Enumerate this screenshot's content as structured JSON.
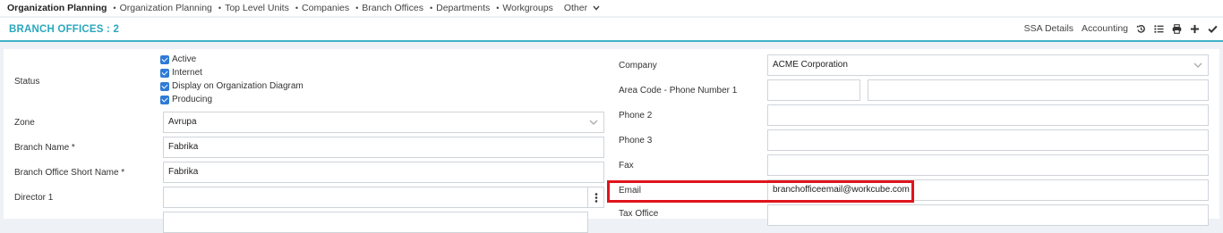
{
  "nav": {
    "items": [
      "Organization Planning",
      "Organization Planning",
      "Top Level Units",
      "Companies",
      "Branch Offices",
      "Departments",
      "Workgroups",
      "Other"
    ],
    "separator": "•"
  },
  "header": {
    "title": "BRANCH OFFICES : 2",
    "ssa_label": "SSA Details",
    "accounting_label": "Accounting"
  },
  "form": {
    "status_label": "Status",
    "checkboxes": [
      "Active",
      "Internet",
      "Display on Organization Diagram",
      "Producing"
    ],
    "zone_label": "Zone",
    "zone_value": "Avrupa",
    "branch_name_label": "Branch Name *",
    "branch_name_value": "Fabrika",
    "short_name_label": "Branch Office Short Name *",
    "short_name_value": "Fabrika",
    "director_label": "Director 1",
    "director_value": "",
    "company_label": "Company",
    "company_value": "ACME Corporation",
    "area_phone_label": "Area Code - Phone Number 1",
    "area_code_value": "",
    "phone1_value": "",
    "phone2_label": "Phone 2",
    "phone2_value": "",
    "phone3_label": "Phone 3",
    "phone3_value": "",
    "fax_label": "Fax",
    "fax_value": "",
    "email_label": "Email",
    "email_value": "branchofficeemail@workcube.com",
    "tax_office_label": "Tax Office",
    "tax_office_value": ""
  },
  "colors": {
    "accent": "#2aa7be",
    "highlight": "#e0141b",
    "checkbox": "#2e7bd6"
  }
}
